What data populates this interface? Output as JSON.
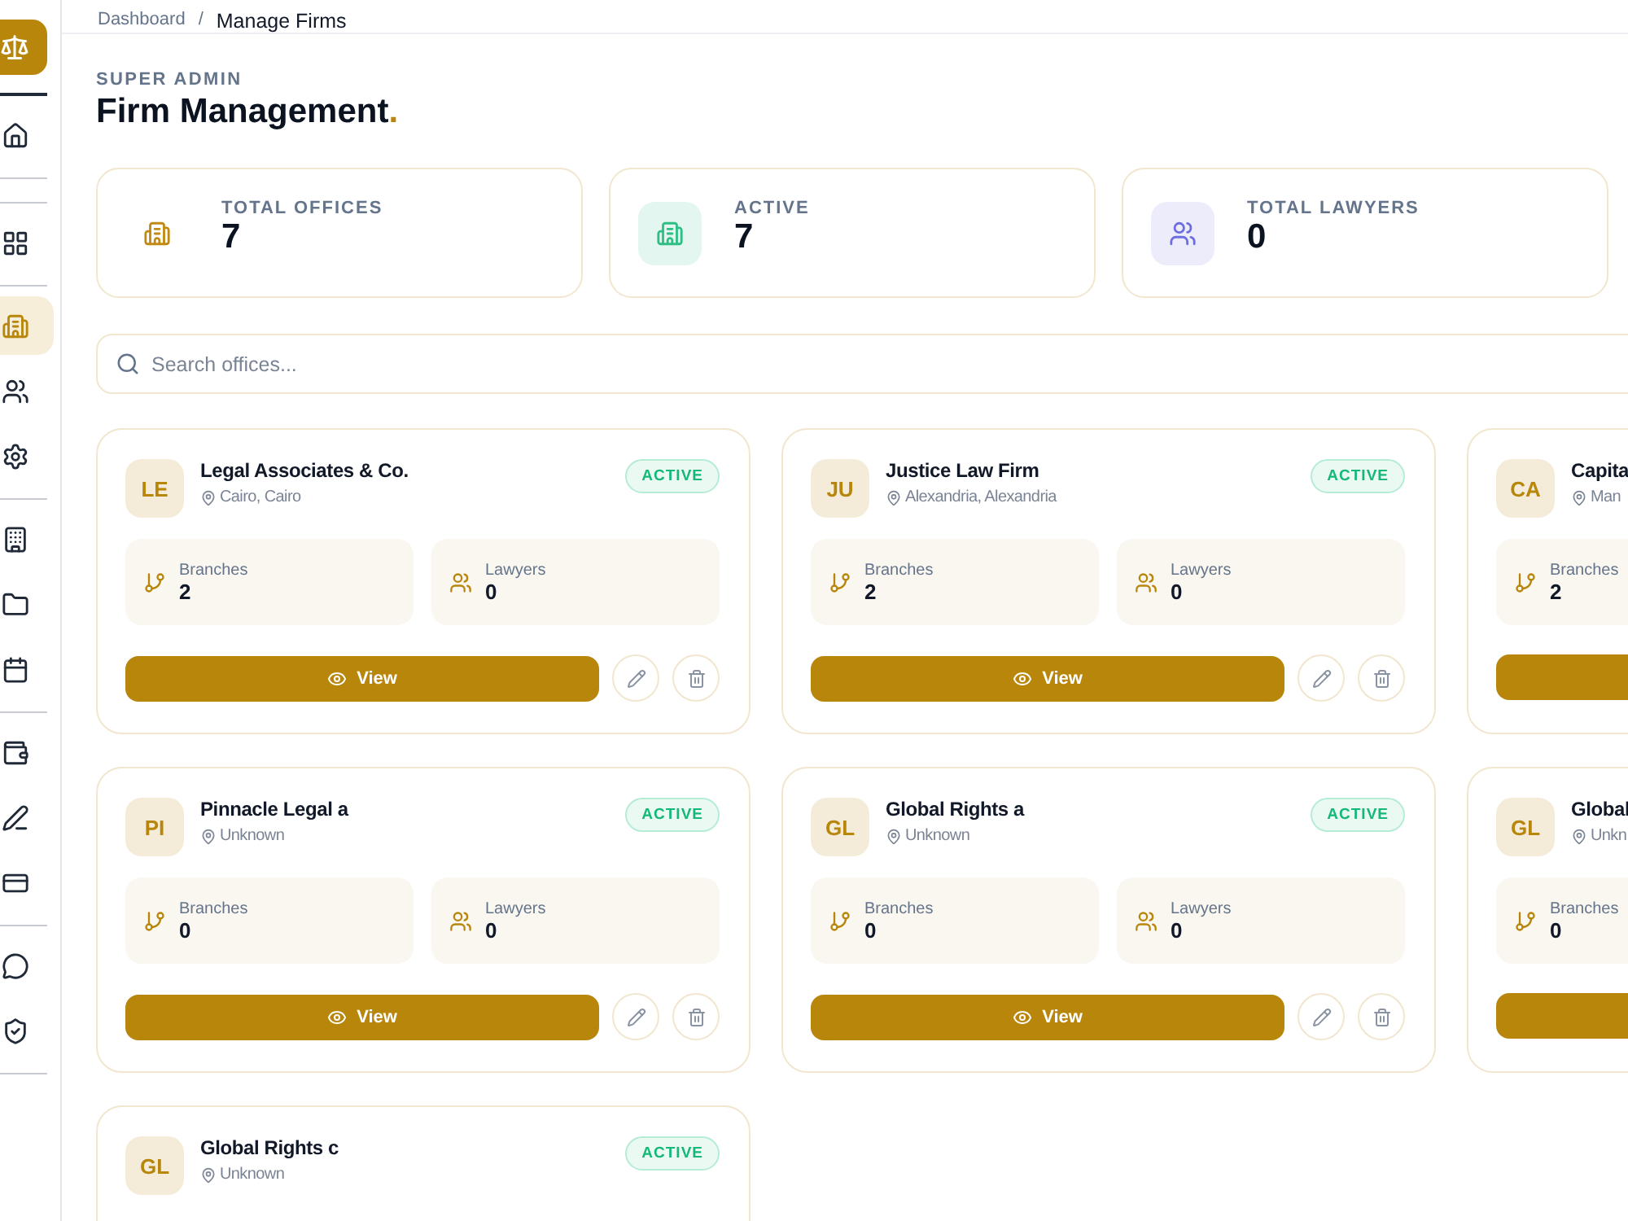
{
  "breadcrumb": [
    {
      "label": "Dashboard",
      "current": false
    },
    {
      "separator": "/",
      "label": "Manage Firms",
      "current": true
    }
  ],
  "sidebar": {
    "groups": [
      {
        "items": [
          {
            "selected": false
          }
        ]
      },
      {
        "items": [
          {
            "selected": false
          }
        ]
      },
      {
        "items": [
          {
            "selected": true
          },
          {
            "selected": false
          },
          {
            "selected": false
          }
        ]
      },
      {
        "items": [
          {
            "selected": false
          },
          {
            "selected": false
          },
          {
            "selected": false
          }
        ]
      },
      {
        "items": [
          {
            "selected": false
          },
          {
            "selected": false
          },
          {
            "selected": false
          }
        ]
      },
      {
        "items": [
          {
            "selected": false
          },
          {
            "selected": false
          }
        ]
      }
    ]
  },
  "header": {
    "eyebrow": "SUPER ADMIN",
    "title": "Firm Management",
    "title_mark": "."
  },
  "stats": [
    {
      "label": "TOTAL OFFICES",
      "value": "7",
      "color": "#c08a14",
      "tinted": false
    },
    {
      "label": "ACTIVE",
      "value": "7",
      "color": "#2fbf85",
      "tinted": true
    },
    {
      "label": "TOTAL LAWYERS",
      "value": "0",
      "color": "#6d6fe0",
      "tinted": true
    }
  ],
  "search": {
    "placeholder": "Search offices..."
  },
  "firms": [
    {
      "initials": "LE",
      "name": "Legal Associates & Co.",
      "location": "Cairo, Cairo",
      "status": "ACTIVE",
      "branches_label": "Branches",
      "branches": "2",
      "lawyers_label": "Lawyers",
      "lawyers": "0",
      "view": "View"
    },
    {
      "initials": "JU",
      "name": "Justice Law Firm",
      "location": "Alexandria, Alexandria",
      "status": "ACTIVE",
      "branches_label": "Branches",
      "branches": "2",
      "lawyers_label": "Lawyers",
      "lawyers": "0",
      "view": "View"
    },
    {
      "initials": "CA",
      "name": "Capita",
      "location": "Man",
      "branches_label": "Branches",
      "branches": "2"
    },
    {
      "initials": "PI",
      "name": "Pinnacle Legal a",
      "location": "Unknown",
      "status": "ACTIVE",
      "branches_label": "Branches",
      "branches": "0",
      "lawyers_label": "Lawyers",
      "lawyers": "0",
      "view": "View"
    },
    {
      "initials": "GL",
      "name": "Global Rights a",
      "location": "Unknown",
      "status": "ACTIVE",
      "branches_label": "Branches",
      "branches": "0",
      "lawyers_label": "Lawyers",
      "lawyers": "0",
      "view": "View"
    },
    {
      "initials": "GL",
      "name": "Global",
      "location": "Unkn",
      "branches_label": "Branches",
      "branches": "0"
    },
    {
      "initials": "GL",
      "name": "Global Rights c",
      "location": "Unknown",
      "status": "ACTIVE"
    }
  ]
}
